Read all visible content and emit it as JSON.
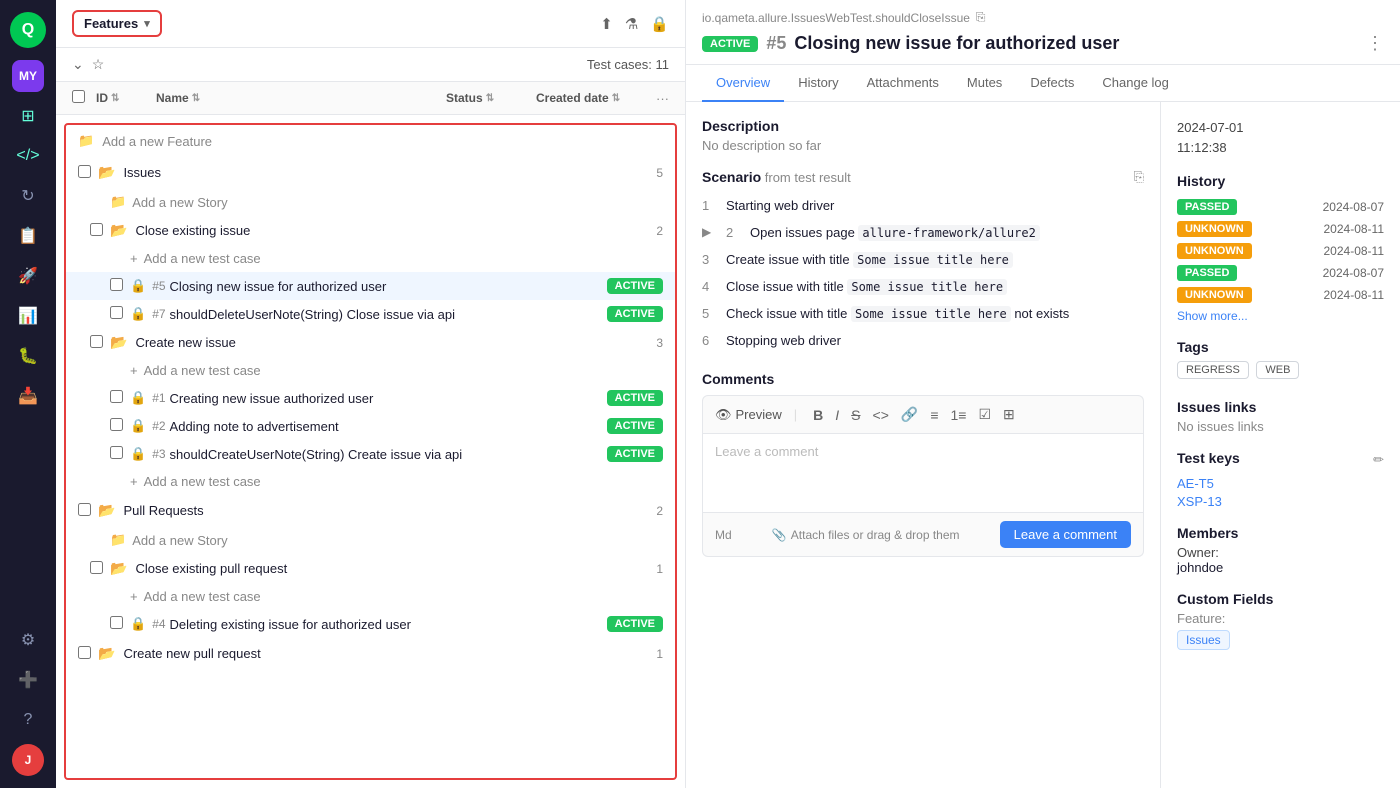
{
  "sidebar": {
    "logo": "Q",
    "avatar_top": "MY",
    "avatar_bottom": "J",
    "icons": [
      "dashboard",
      "code",
      "refresh",
      "clipboard",
      "rocket",
      "chart",
      "bug",
      "inbox",
      "settings",
      "add",
      "help"
    ]
  },
  "left_panel": {
    "features_label": "Features",
    "test_cases_count": "Test cases: 11",
    "columns": {
      "id": "ID",
      "name": "Name",
      "status": "Status",
      "created_date": "Created date"
    },
    "tree": {
      "add_feature": "Add a new Feature",
      "groups": [
        {
          "name": "Issues",
          "count": 5,
          "add_story": "Add a new Story",
          "stories": [
            {
              "name": "Close existing issue",
              "count": 2,
              "add_test": "Add a new test case",
              "tests": [
                {
                  "id": "#5",
                  "name": "Closing new issue for authorized user",
                  "status": "ACTIVE",
                  "active": true
                },
                {
                  "id": "#7",
                  "name": "shouldDeleteUserNote(String) Close issue via api",
                  "status": "ACTIVE",
                  "active": false
                }
              ]
            },
            {
              "name": "Create new issue",
              "count": 3,
              "add_test": "Add a new test case",
              "tests": [
                {
                  "id": "#1",
                  "name": "Creating new issue authorized user",
                  "status": "ACTIVE",
                  "active": false
                },
                {
                  "id": "#2",
                  "name": "Adding note to advertisement",
                  "status": "ACTIVE",
                  "active": false
                },
                {
                  "id": "#3",
                  "name": "shouldCreateUserNote(String) Create issue via api",
                  "status": "ACTIVE",
                  "active": false
                }
              ],
              "add_test_bottom": "Add a new test case"
            }
          ]
        },
        {
          "name": "Pull Requests",
          "count": 2,
          "add_story": "Add a new Story",
          "stories": [
            {
              "name": "Close existing pull request",
              "count": 1,
              "add_test": "Add a new test case",
              "tests": [
                {
                  "id": "#4",
                  "name": "Deleting existing issue for authorized user",
                  "status": "ACTIVE",
                  "active": false
                }
              ]
            }
          ]
        },
        {
          "name": "Create new pull request",
          "count": 1
        }
      ]
    }
  },
  "right_panel": {
    "breadcrumb": "io.qameta.allure.IssuesWebTest.shouldCloseIssue",
    "active_badge": "ACTIVE",
    "test_number": "#5",
    "test_title": "Closing new issue for authorized user",
    "tabs": [
      "Overview",
      "History",
      "Attachments",
      "Mutes",
      "Defects",
      "Change log"
    ],
    "active_tab": "Overview",
    "description": {
      "label": "Description",
      "text": "No description so far"
    },
    "scenario": {
      "label": "Scenario",
      "sublabel": "from test result",
      "steps": [
        {
          "num": "1",
          "text": "Starting web driver"
        },
        {
          "num": "2",
          "text": "Open issues page `allure-framework/allure2`",
          "has_toggle": true
        },
        {
          "num": "3",
          "text": "Create issue with title `Some issue title here`"
        },
        {
          "num": "4",
          "text": "Close issue with title `Some issue title here`"
        },
        {
          "num": "5",
          "text": "Check issue with title `Some issue title here` not exists"
        },
        {
          "num": "6",
          "text": "Stopping web driver"
        }
      ]
    },
    "comments": {
      "label": "Comments",
      "preview_label": "Preview",
      "placeholder": "Leave a comment",
      "attach_hint": "Attach files or drag & drop them",
      "leave_comment_btn": "Leave a comment"
    },
    "sidebar": {
      "date_line1": "2024-07-01",
      "date_line2": "11:12:38",
      "history_title": "History",
      "history_items": [
        {
          "status": "PASSED",
          "date": "2024-08-07"
        },
        {
          "status": "UNKNOWN",
          "date": "2024-08-11"
        },
        {
          "status": "UNKNOWN",
          "date": "2024-08-11"
        },
        {
          "status": "PASSED",
          "date": "2024-08-07"
        },
        {
          "status": "UNKNOWN",
          "date": "2024-08-11"
        }
      ],
      "show_more": "Show more...",
      "tags_title": "Tags",
      "tags": [
        "REGRESS",
        "WEB"
      ],
      "issues_links_title": "Issues links",
      "no_links": "No issues links",
      "test_keys_title": "Test keys",
      "test_keys": [
        "AE-T5",
        "XSP-13"
      ],
      "members_title": "Members",
      "owner_label": "Owner:",
      "owner_name": "johndoe",
      "custom_fields_title": "Custom Fields",
      "custom_field_label": "Feature:",
      "custom_field_value": "Issues"
    }
  }
}
